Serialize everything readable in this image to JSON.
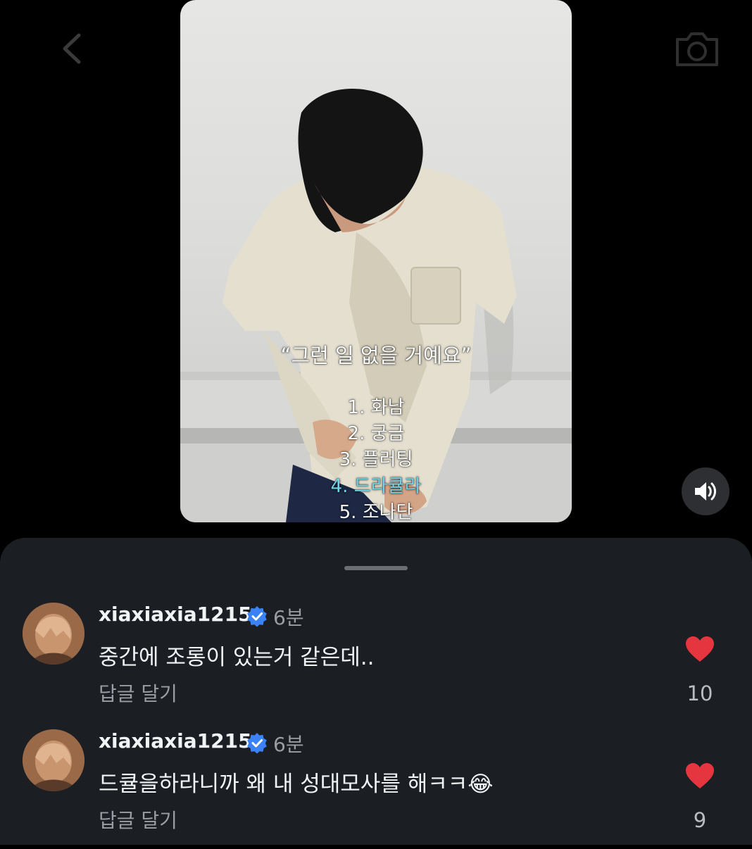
{
  "video": {
    "caption_quote": "“그런 일 없을 거예요”",
    "list": [
      "1. 화남",
      "2. 궁금",
      "3. 플러팅",
      "4. 드라큘라",
      "5. 조나단"
    ],
    "highlight_index": 3,
    "highlight_color": "#6fd6e6"
  },
  "icons": {
    "back": "chevron-left-icon",
    "camera": "camera-icon",
    "sound": "speaker-icon",
    "verified": "verified-badge-icon",
    "like": "heart-icon"
  },
  "comments": [
    {
      "username": "xiaxiaxia1215",
      "time": "6분",
      "text": "중간에 조롱이 있는거 같은데..",
      "reply_label": "답글 달기",
      "likes": "10"
    },
    {
      "username": "xiaxiaxia1215",
      "time": "6분",
      "text": "드큘을하라니까 왜 내 성대모사를 해ㅋㅋ😂",
      "reply_label": "답글 달기",
      "likes": "9"
    }
  ],
  "colors": {
    "sheet_bg": "#1b1e23",
    "heart": "#e5363f",
    "verified": "#3b82f6"
  }
}
